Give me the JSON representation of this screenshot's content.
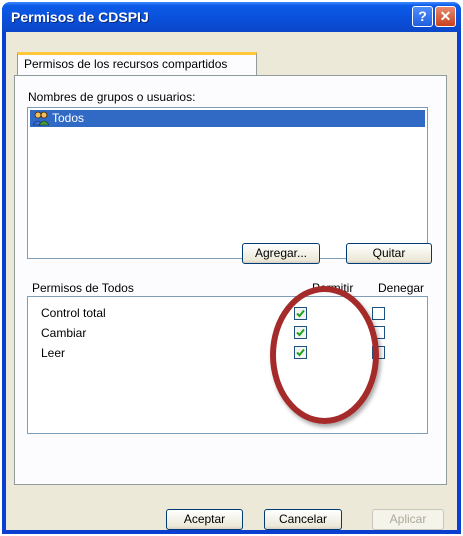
{
  "window": {
    "title": "Permisos de CDSPIJ",
    "help_label": "?",
    "close_label": "✕"
  },
  "tab": {
    "label": "Permisos de los recursos compartidos"
  },
  "groups": {
    "label": "Nombres de grupos o usuarios:",
    "items": [
      {
        "name": "Todos",
        "icon": "users-group-icon",
        "selected": true
      }
    ]
  },
  "buttons": {
    "add": "Agregar...",
    "remove": "Quitar",
    "ok": "Aceptar",
    "cancel": "Cancelar",
    "apply": "Aplicar"
  },
  "permissions": {
    "label": "Permisos de Todos",
    "allow_header": "Permitir",
    "deny_header": "Denegar",
    "rows": [
      {
        "name": "Control total",
        "allow": true,
        "deny": false
      },
      {
        "name": "Cambiar",
        "allow": true,
        "deny": false
      },
      {
        "name": "Leer",
        "allow": true,
        "deny": false
      }
    ]
  },
  "colors": {
    "title_bar": "#0a4fd9",
    "selection": "#316ac5",
    "annotation_circle": "#a52a2a",
    "checkmark": "#21a121"
  }
}
